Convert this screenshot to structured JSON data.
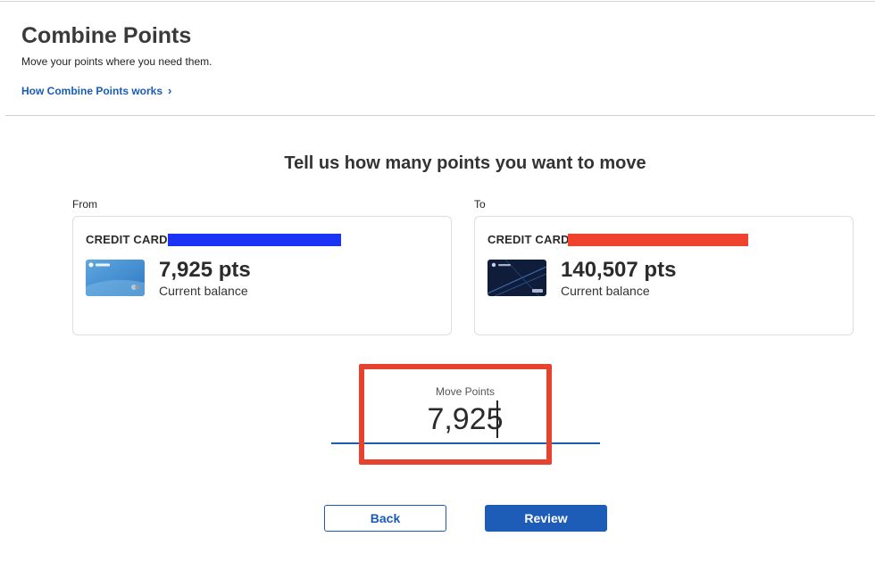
{
  "header": {
    "title": "Combine Points",
    "subtitle": "Move your points where you need them.",
    "how_link": "How Combine Points works"
  },
  "main": {
    "heading": "Tell us how many points you want to move",
    "from": {
      "label": "From",
      "card_name": "CREDIT CARD (",
      "points": "7,925 pts",
      "balance_label": "Current balance",
      "redaction_color": "#1a33f5"
    },
    "to": {
      "label": "To",
      "card_name": "CREDIT CARD",
      "points": "140,507 pts",
      "balance_label": "Current balance",
      "redaction_color": "#ef4330"
    },
    "move_points": {
      "label": "Move Points",
      "value": "7,925"
    }
  },
  "actions": {
    "back_label": "Back",
    "review_label": "Review"
  },
  "colors": {
    "link_blue": "#1a5bb4",
    "primary_button": "#1d5db7",
    "highlight_red": "#e6432e"
  }
}
